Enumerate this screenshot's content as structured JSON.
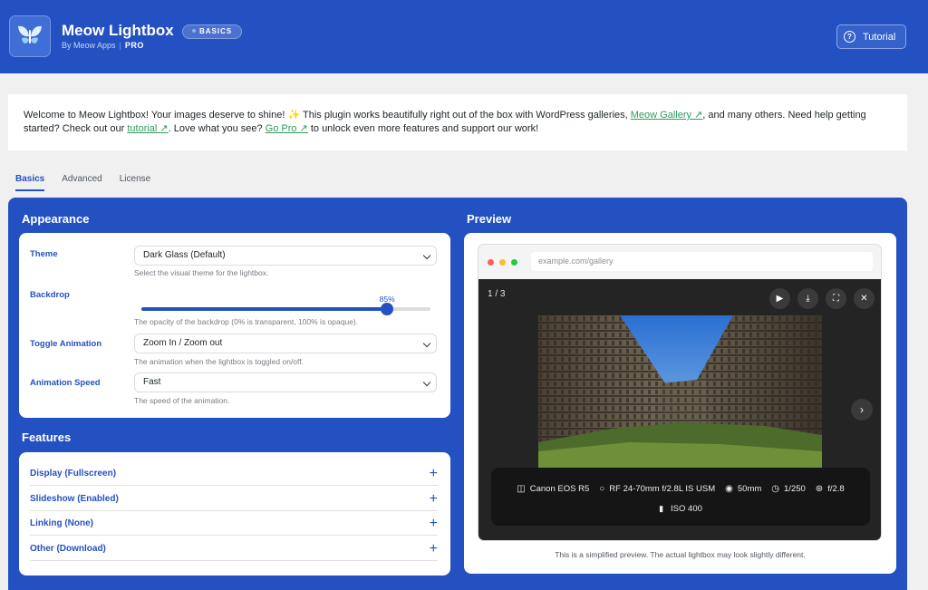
{
  "header": {
    "title": "Meow Lightbox",
    "byline": "By Meow Apps",
    "pro": "PRO",
    "breadcrumb_sep": "›",
    "page_badge": "BASICS",
    "tutorial_label": "Tutorial"
  },
  "welcome": {
    "text1": "Welcome to Meow Lightbox! Your images deserve to shine! ✨ This plugin works beautifully right out of the box with WordPress galleries, ",
    "link1": "Meow Gallery ↗",
    "text2": ", and many others. Need help getting started? Check out our ",
    "link2": "tutorial ↗",
    "text3": ". Love what you see? ",
    "link3": "Go Pro ↗",
    "text4": " to unlock even more features and support our work!"
  },
  "tabs": [
    {
      "label": "Basics",
      "active": true
    },
    {
      "label": "Advanced",
      "active": false
    },
    {
      "label": "License",
      "active": false
    }
  ],
  "appearance": {
    "title": "Appearance",
    "theme": {
      "label": "Theme",
      "value": "Dark Glass (Default)",
      "help": "Select the visual theme for the lightbox."
    },
    "backdrop": {
      "label": "Backdrop",
      "value": 85,
      "value_label": "85%",
      "help": "The opacity of the backdrop (0% is transparent, 100% is opaque)."
    },
    "toggle": {
      "label": "Toggle Animation",
      "value": "Zoom In / Zoom out",
      "help": "The animation when the lightbox is toggled on/off."
    },
    "speed": {
      "label": "Animation Speed",
      "value": "Fast",
      "help": "The speed of the animation."
    }
  },
  "features": {
    "title": "Features",
    "items": [
      {
        "label": "Display (Fullscreen)"
      },
      {
        "label": "Slideshow (Enabled)"
      },
      {
        "label": "Linking (None)"
      },
      {
        "label": "Other (Download)"
      }
    ]
  },
  "preview": {
    "title": "Preview",
    "url": "example.com/gallery",
    "counter": "1 / 3",
    "exif": {
      "camera": "Canon EOS R5",
      "lens": "RF 24-70mm f/2.8L IS USM",
      "focal": "50mm",
      "shutter": "1/250",
      "aperture": "f/2.8",
      "iso": "ISO 400"
    },
    "note": "This is a simplified preview. The actual lightbox may look slightly different."
  },
  "colors": {
    "brand": "#2451c1",
    "link": "#2d9a5a",
    "lightbox_bg": "#242424"
  }
}
